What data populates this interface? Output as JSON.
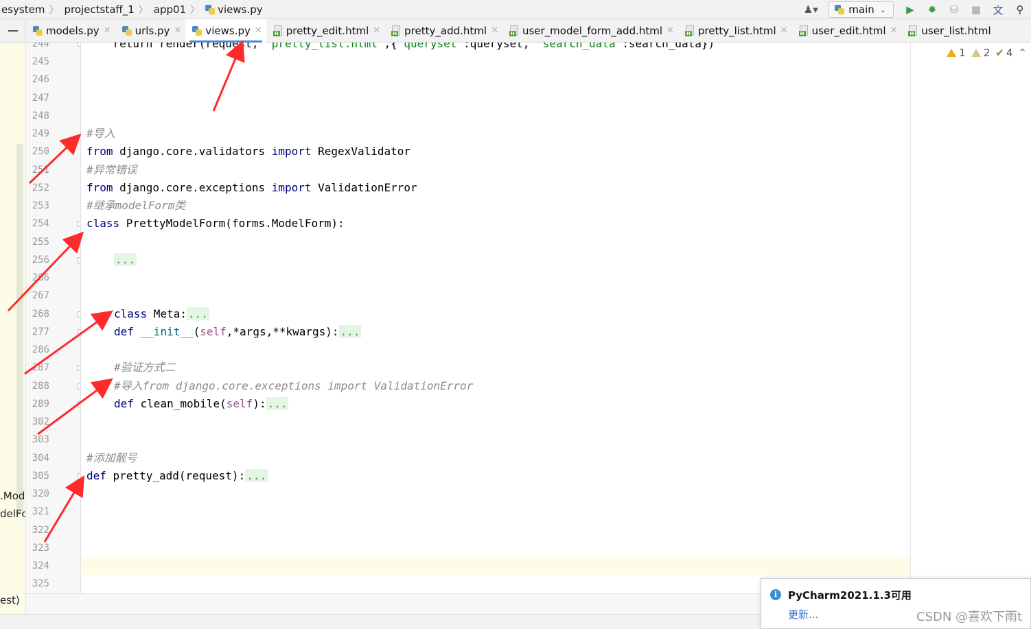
{
  "breadcrumbs": [
    "esystem",
    "projectstaff_1",
    "app01",
    "views.py"
  ],
  "toolbar": {
    "branch": "main",
    "icons": [
      "user-icon",
      "python-icon",
      "run-icon",
      "debug-icon",
      "coverage-icon",
      "stop-icon",
      "translate-icon",
      "search-icon"
    ]
  },
  "tabs": [
    {
      "label": "models.py",
      "type": "py",
      "active": false
    },
    {
      "label": "urls.py",
      "type": "py",
      "active": false
    },
    {
      "label": "views.py",
      "type": "py",
      "active": true
    },
    {
      "label": "pretty_edit.html",
      "type": "html",
      "active": false
    },
    {
      "label": "pretty_add.html",
      "type": "html",
      "active": false
    },
    {
      "label": "user_model_form_add.html",
      "type": "html",
      "active": false
    },
    {
      "label": "pretty_list.html",
      "type": "html",
      "active": false
    },
    {
      "label": "user_edit.html",
      "type": "html",
      "active": false
    },
    {
      "label": "user_list.html",
      "type": "html",
      "active": false
    }
  ],
  "left_panel_fragments": [
    ".Mod",
    "delFc",
    "est)"
  ],
  "inspections": {
    "warnings": "1",
    "weak_warnings": "2",
    "typos": "4"
  },
  "line_numbers": [
    "244",
    "245",
    "246",
    "247",
    "248",
    "249",
    "250",
    "251",
    "252",
    "253",
    "254",
    "255",
    "256",
    "266",
    "267",
    "268",
    "277",
    "286",
    "287",
    "288",
    "289",
    "302",
    "303",
    "304",
    "305",
    "320",
    "321",
    "322",
    "323",
    "324",
    "325"
  ],
  "code": {
    "l244": {
      "pre": "    return render(request, ",
      "s1": "'pretty_list.html'",
      "m1": ",{",
      "s2": "'queryset'",
      "m2": ":queryset, ",
      "s3": "'search_data'",
      "m3": ":search_data})"
    },
    "l249": "#导入",
    "l250": {
      "kw1": "from",
      "mod": " django.core.validators ",
      "kw2": "import",
      "name": " RegexValidator"
    },
    "l251": "#异常错误",
    "l252": {
      "kw1": "from",
      "mod": " django.core.exceptions ",
      "kw2": "import",
      "name": " ValidationError"
    },
    "l253": "#继承modelForm类",
    "l254": {
      "kw": "class",
      "rest": " PrettyModelForm(forms.ModelForm):"
    },
    "l256": "...",
    "l268": {
      "kw": "class",
      "rest": " Meta:",
      "dots": "..."
    },
    "l277": {
      "kw": "def",
      "fn": " __init__",
      "p1": "(",
      "self": "self",
      "p2": ",*args,**kwargs):",
      "dots": "..."
    },
    "l287": "#验证方式二",
    "l288": "#导入from django.core.exceptions import ValidationError",
    "l289": {
      "kw": "def",
      "fn": " clean_mobile",
      "p1": "(",
      "self": "self",
      "p2": "):",
      "dots": "..."
    },
    "l304": "#添加靓号",
    "l305": {
      "kw": "def",
      "rest": " pretty_add(request):",
      "dots": "..."
    }
  },
  "notification": {
    "title": "PyCharm2021.1.3可用",
    "link": "更新..."
  },
  "watermark": "CSDN @喜欢下雨t",
  "colors": {
    "keyword": "#000080",
    "comment": "#8c8c8c",
    "self": "#94558d",
    "string": "#067d17",
    "arrow": "#ff2a2a",
    "tab_underline": "#4a8bd6"
  }
}
